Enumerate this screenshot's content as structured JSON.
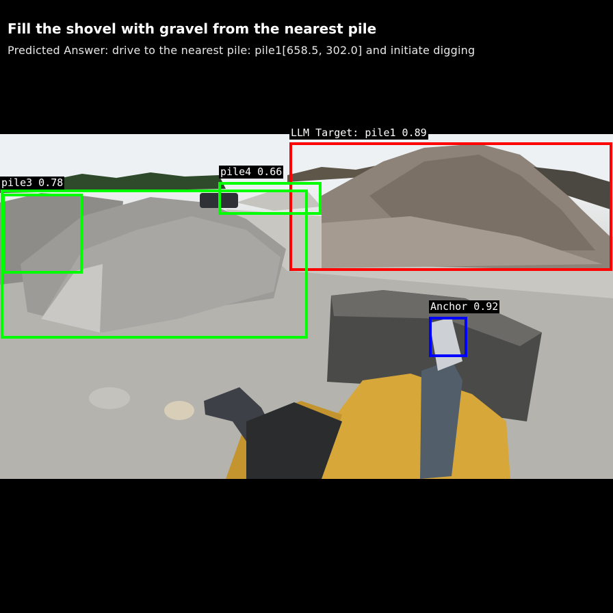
{
  "header": {
    "title": "Fill the shovel with gravel from the nearest pile",
    "subtitle": "Predicted Answer: drive to the nearest pile: pile1[658.5, 302.0] and initiate digging"
  },
  "detections": {
    "pile1": {
      "label": "LLM Target: pile1 0.89",
      "color": "#ff0000"
    },
    "pile3": {
      "label": "pile3 0.78",
      "color": "#00ff00"
    },
    "pile4": {
      "label": "pile4 0.66",
      "color": "#00ff00"
    },
    "anchor": {
      "label": "Anchor 0.92",
      "color": "#0000ff"
    }
  }
}
